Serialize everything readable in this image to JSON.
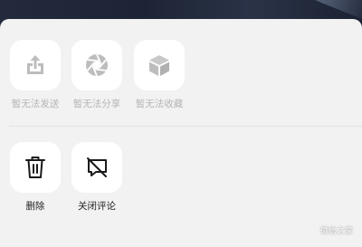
{
  "row1": [
    {
      "label": "暂无法发送",
      "icon": "share-upload-icon"
    },
    {
      "label": "暂无法分享",
      "icon": "aperture-icon"
    },
    {
      "label": "暂无法收藏",
      "icon": "cube-icon"
    }
  ],
  "row2": [
    {
      "label": "删除",
      "icon": "trash-icon"
    },
    {
      "label": "关闭评论",
      "icon": "comment-off-icon"
    }
  ],
  "watermark": "微信之家"
}
